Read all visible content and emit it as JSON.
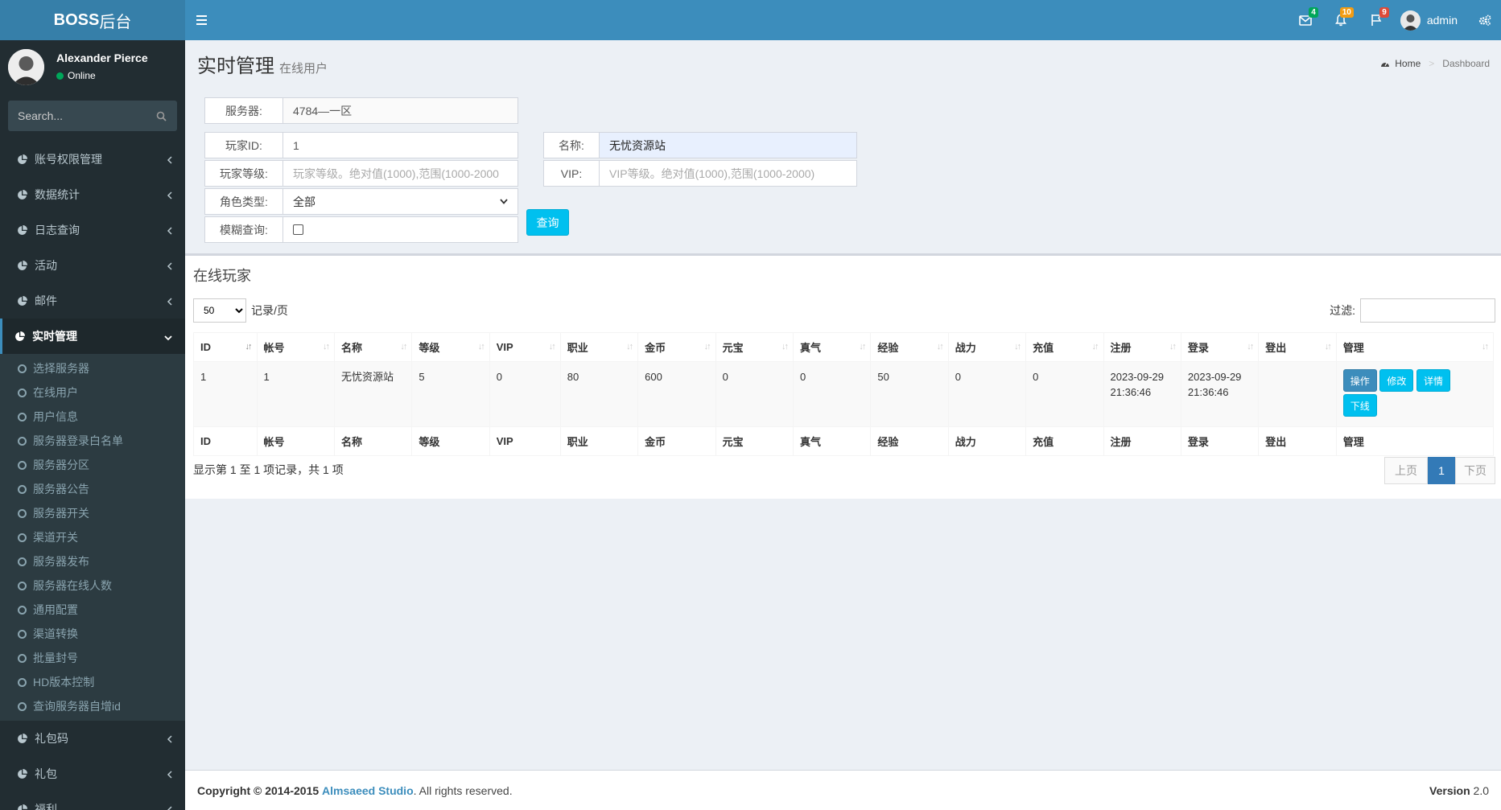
{
  "brand": {
    "bold": "BOSS",
    "rest": "后台"
  },
  "header": {
    "mail_badge": "4",
    "bell_badge": "10",
    "flag_badge": "9",
    "user_name": "admin",
    "colors": {
      "mail": "#00a65a",
      "bell": "#f39c12",
      "flag": "#dd4b39"
    }
  },
  "user_panel": {
    "name": "Alexander Pierce",
    "status": "Online"
  },
  "search": {
    "placeholder": "Search..."
  },
  "menu": {
    "items_top": [
      "账号权限管理",
      "数据统计",
      "日志查询",
      "活动",
      "邮件"
    ],
    "active": "实时管理",
    "sub_items": [
      "选择服务器",
      "在线用户",
      "用户信息",
      "服务器登录白名单",
      "服务器分区",
      "服务器公告",
      "服务器开关",
      "渠道开关",
      "服务器发布",
      "服务器在线人数",
      "通用配置",
      "渠道转换",
      "批量封号",
      "HD版本控制",
      "查询服务器自增id"
    ],
    "items_bottom": [
      "礼包码",
      "礼包",
      "福利"
    ]
  },
  "page": {
    "title": "实时管理",
    "subtitle": "在线用户"
  },
  "breadcrumb": {
    "home": "Home",
    "current": "Dashboard"
  },
  "form": {
    "server_label": "服务器:",
    "server_value": "4784—一区",
    "player_id_label": "玩家ID:",
    "player_id_value": "1",
    "level_label": "玩家等级:",
    "level_placeholder": "玩家等级。绝对值(1000),范围(1000-2000",
    "role_label": "角色类型:",
    "role_value": "全部",
    "fuzzy_label": "模糊查询:",
    "name_label": "名称:",
    "name_value": "无忧资源站",
    "vip_label": "VIP:",
    "vip_placeholder": "VIP等级。绝对值(1000),范围(1000-2000)",
    "query_button": "查询"
  },
  "box": {
    "title": "在线玩家",
    "page_length": "50",
    "length_suffix": "记录/页",
    "filter_label": "过滤:"
  },
  "table": {
    "columns": [
      "ID",
      "帐号",
      "名称",
      "等级",
      "VIP",
      "职业",
      "金币",
      "元宝",
      "真气",
      "经验",
      "战力",
      "充值",
      "注册",
      "登录",
      "登出",
      "管理"
    ],
    "rows": [
      {
        "id": "1",
        "account": "1",
        "name": "无忧资源站",
        "level": "5",
        "vip": "0",
        "job": "80",
        "gold": "600",
        "yuanbao": "0",
        "zhenqi": "0",
        "exp": "50",
        "power": "0",
        "recharge": "0",
        "register_date": "2023-09-29",
        "register_time": "21:36:46",
        "login_date": "2023-09-29",
        "login_time": "21:36:46",
        "logout": "",
        "actions": [
          "操作",
          "修改",
          "详情",
          "下线"
        ]
      }
    ]
  },
  "info": "显示第 1 至 1 项记录，共 1 项",
  "pager": {
    "prev": "上页",
    "current": "1",
    "next": "下页"
  },
  "footer": {
    "copyright": "Copyright © 2014-2015",
    "studio": "Almsaeed Studio",
    "rights": ". All rights reserved.",
    "version_label": "Version",
    "version": "2.0"
  }
}
